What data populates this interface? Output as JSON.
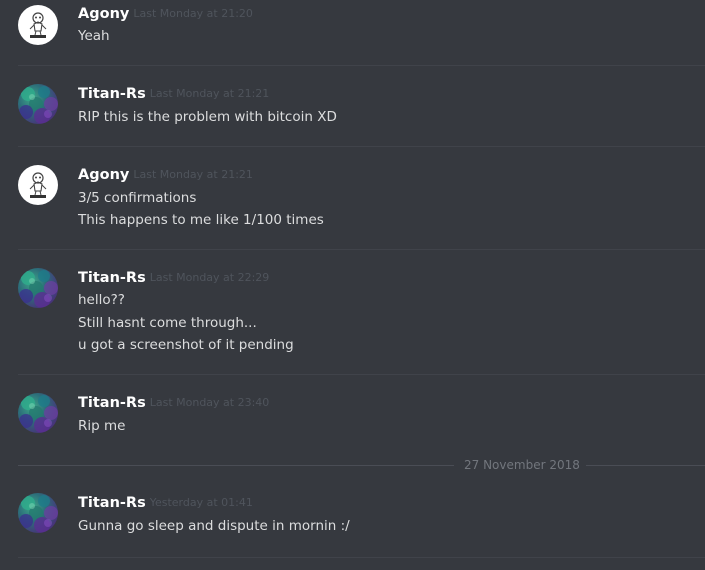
{
  "messages": [
    {
      "author": "Agony",
      "timestamp": "Last Monday at 21:20",
      "avatar": "agony-avatar-icon",
      "lines": [
        "Yeah"
      ]
    },
    {
      "author": "Titan-Rs",
      "timestamp": "Last Monday at 21:21",
      "avatar": "titan-avatar-icon",
      "lines": [
        "RIP this is the problem with bitcoin XD"
      ]
    },
    {
      "author": "Agony",
      "timestamp": "Last Monday at 21:21",
      "avatar": "agony-avatar-icon",
      "lines": [
        "3/5 confirmations",
        "This happens to me like 1/100 times"
      ]
    },
    {
      "author": "Titan-Rs",
      "timestamp": "Last Monday at 22:29",
      "avatar": "titan-avatar-icon",
      "lines": [
        "hello??",
        "Still hasnt come through...",
        "u got a screenshot of it pending"
      ]
    },
    {
      "author": "Titan-Rs",
      "timestamp": "Last Monday at 23:40",
      "avatar": "titan-avatar-icon",
      "lines": [
        "Rip me"
      ]
    },
    {
      "author": "Titan-Rs",
      "timestamp": "Yesterday at 01:41",
      "avatar": "titan-avatar-icon",
      "lines": [
        "Gunna go sleep and dispute in mornin :/"
      ]
    }
  ],
  "date_divider": "27 November 2018",
  "colors": {
    "background": "#36393f",
    "username": "#ffffff",
    "message_text": "#dcddde",
    "timestamp": "#4f545c",
    "divider": "#40434a"
  }
}
